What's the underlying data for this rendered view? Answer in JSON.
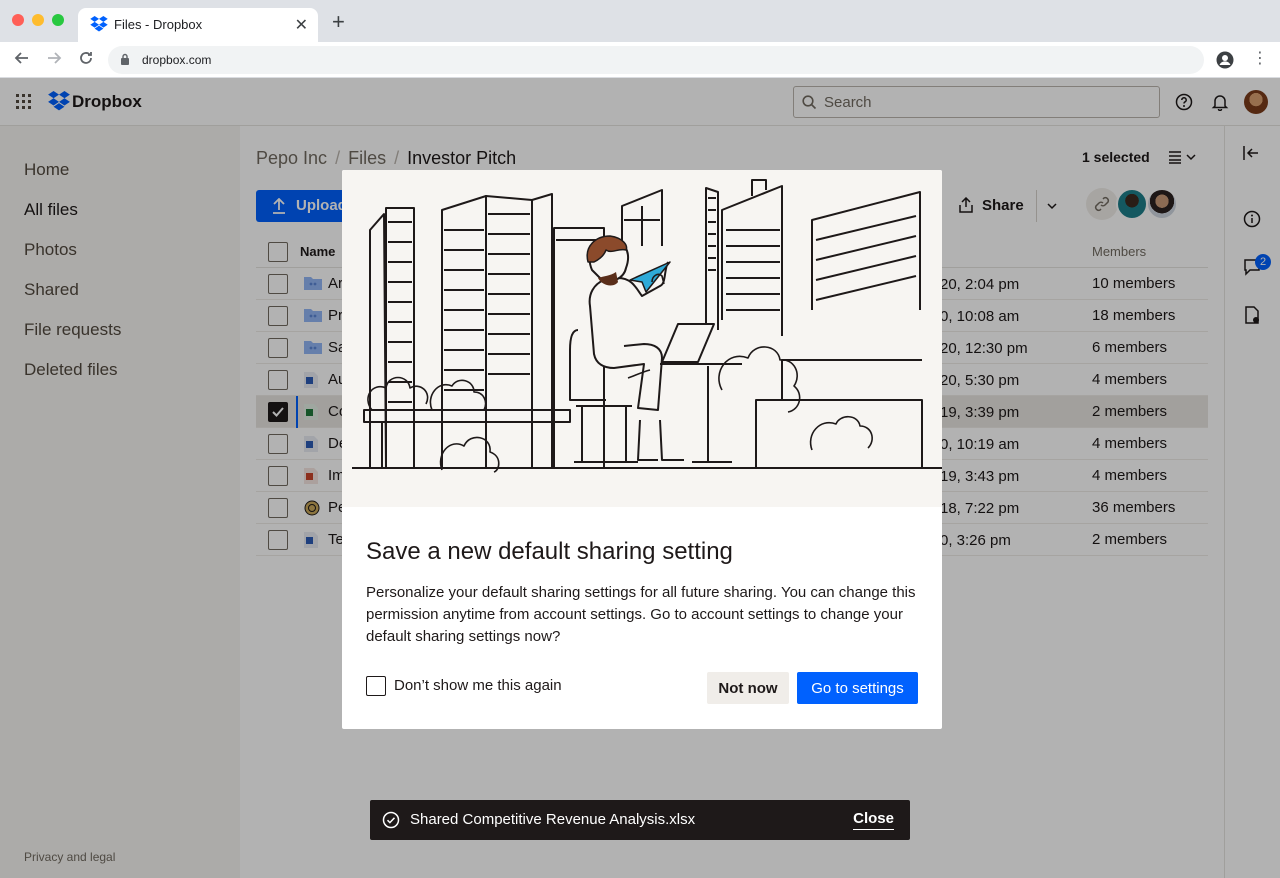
{
  "browser": {
    "tab_title": "Files - Dropbox",
    "url": "dropbox.com",
    "new_tab": "+",
    "close_tab": "✕"
  },
  "app": {
    "brand": "Dropbox",
    "search_placeholder": "Search"
  },
  "sidebar": {
    "items": [
      "Home",
      "All files",
      "Photos",
      "Shared",
      "File requests",
      "Deleted files"
    ],
    "footer": "Privacy and legal"
  },
  "main": {
    "breadcrumb": [
      "Pepo Inc",
      "Investor Pitch"
    ],
    "breadcrumb_middle": "Files",
    "selected_count": "1 selected",
    "upload_label": "Upload",
    "share_label": "Share",
    "columns": {
      "name": "Name",
      "members": "Members"
    },
    "rows": [
      {
        "name": "Ar",
        "date": "20, 2:04 pm",
        "members": "10 members",
        "type": "folder"
      },
      {
        "name": "Pr",
        "date": "0, 10:08 am",
        "members": "18 members",
        "type": "folder"
      },
      {
        "name": "Sa",
        "date": "20, 12:30 pm",
        "members": "6 members",
        "type": "folder"
      },
      {
        "name": "Au",
        "date": "20, 5:30 pm",
        "members": "4 members",
        "type": "doc"
      },
      {
        "name": "Co",
        "date": "19, 3:39 pm",
        "members": "2 members",
        "type": "sheet",
        "selected": true
      },
      {
        "name": "De",
        "date": "0, 10:19 am",
        "members": "4 members",
        "type": "doc"
      },
      {
        "name": "Im",
        "date": "19, 3:43 pm",
        "members": "4 members",
        "type": "ppt"
      },
      {
        "name": "Pe",
        "date": "18, 7:22 pm",
        "members": "36 members",
        "type": "other"
      },
      {
        "name": "Te",
        "date": "0, 3:26 pm",
        "members": "2 members",
        "type": "doc"
      }
    ]
  },
  "rightrail": {
    "comment_badge": "2"
  },
  "modal": {
    "title": "Save a new default sharing setting",
    "body": "Personalize your default sharing settings for all future sharing. You can change this permission anytime from account settings. Go to account settings to change your default sharing settings now?",
    "checkbox_label": "Don’t show me this again",
    "secondary_button": "Not now",
    "primary_button": "Go to settings"
  },
  "toast": {
    "message": "Shared Competitive Revenue Analysis.xlsx",
    "close": "Close"
  },
  "colors": {
    "accent": "#0061fe",
    "text": "#1e1919",
    "overlay": "rgba(0,0,0,0.3)"
  }
}
